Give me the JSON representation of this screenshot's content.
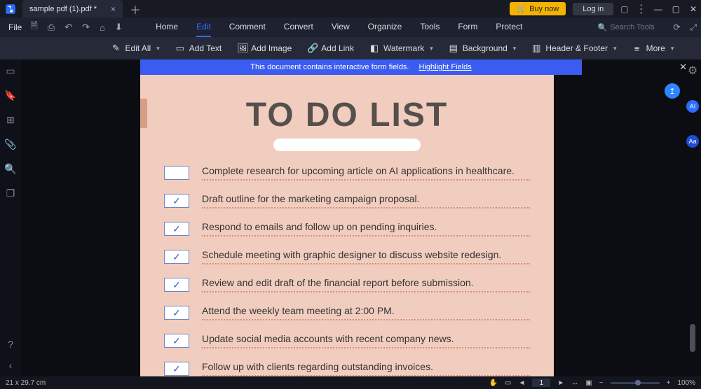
{
  "titlebar": {
    "filename": "sample pdf (1).pdf *",
    "buy_label": "Buy now",
    "login_label": "Log in"
  },
  "menubar": {
    "file_label": "File",
    "items": [
      "Home",
      "Edit",
      "Comment",
      "Convert",
      "View",
      "Organize",
      "Tools",
      "Form",
      "Protect"
    ],
    "active_index": 1,
    "search_placeholder": "Search Tools"
  },
  "ribbon": {
    "edit_all": "Edit All",
    "add_text": "Add Text",
    "add_image": "Add Image",
    "add_link": "Add Link",
    "watermark": "Watermark",
    "background": "Background",
    "header_footer": "Header & Footer",
    "more": "More"
  },
  "banner": {
    "message": "This document contains interactive form fields.",
    "action": "Highlight Fields"
  },
  "document": {
    "title": "TO DO LIST",
    "items": [
      {
        "checked": false,
        "text": "Complete research for upcoming article on AI applications in healthcare."
      },
      {
        "checked": true,
        "text": "Draft outline for the marketing campaign proposal."
      },
      {
        "checked": true,
        "text": "Respond to emails and follow up on pending inquiries."
      },
      {
        "checked": true,
        "text": "Schedule meeting with graphic designer to discuss website redesign."
      },
      {
        "checked": true,
        "text": "Review and edit draft of the financial report before submission."
      },
      {
        "checked": true,
        "text": "Attend the weekly team meeting at 2:00 PM."
      },
      {
        "checked": true,
        "text": "Update social media accounts with recent company news."
      },
      {
        "checked": true,
        "text": "Follow up with clients regarding outstanding invoices."
      }
    ]
  },
  "status": {
    "page_size": "21 x 29.7 cm",
    "page_current": "1",
    "zoom": "100%"
  }
}
